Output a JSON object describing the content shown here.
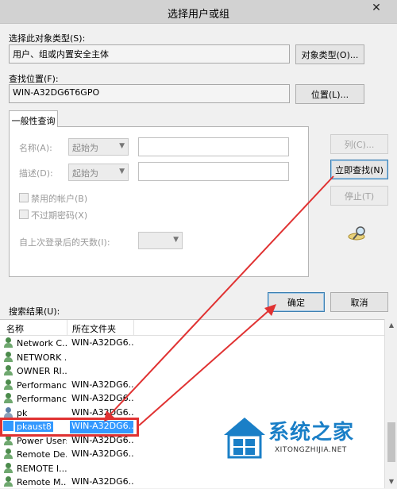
{
  "dialog": {
    "title": "选择用户或组",
    "close_glyph": "✕"
  },
  "object_type": {
    "label": "选择此对象类型(S):",
    "value": "用户、组或内置安全主体",
    "button": "对象类型(O)..."
  },
  "location": {
    "label": "查找位置(F):",
    "value": "WIN-A32DG6T6GPO",
    "button": "位置(L)..."
  },
  "query": {
    "tab": "一般性查询",
    "name_label": "名称(A):",
    "name_mode": "起始为",
    "desc_label": "描述(D):",
    "desc_mode": "起始为",
    "disabled_accounts": "禁用的帐户(B)",
    "non_expiring_pwd": "不过期密码(X)",
    "days_since_login": "自上次登录后的天数(I):"
  },
  "side_buttons": {
    "columns": "列(C)...",
    "find_now": "立即查找(N)",
    "stop": "停止(T)"
  },
  "results": {
    "label": "搜索结果(U):",
    "ok": "确定",
    "cancel": "取消",
    "col_name": "名称",
    "col_folder": "所在文件夹",
    "rows": [
      {
        "name": "Network C...",
        "folder": "WIN-A32DG6...",
        "icon": "group-icon"
      },
      {
        "name": "NETWORK ...",
        "folder": "",
        "icon": "group-icon"
      },
      {
        "name": "OWNER RI...",
        "folder": "",
        "icon": "group-icon"
      },
      {
        "name": "Performanc...",
        "folder": "WIN-A32DG6...",
        "icon": "group-icon"
      },
      {
        "name": "Performanc...",
        "folder": "WIN-A32DG6...",
        "icon": "group-icon"
      },
      {
        "name": "pk",
        "folder": "WIN-A32DG6...",
        "icon": "user-icon"
      },
      {
        "name": "pkaust8",
        "folder": "WIN-A32DG6...",
        "icon": "user-icon",
        "selected": true
      },
      {
        "name": "Power Users",
        "folder": "WIN-A32DG6...",
        "icon": "group-icon"
      },
      {
        "name": "Remote De...",
        "folder": "WIN-A32DG6...",
        "icon": "group-icon"
      },
      {
        "name": "REMOTE I...",
        "folder": "",
        "icon": "group-icon"
      },
      {
        "name": "Remote M...",
        "folder": "WIN-A32DG6...",
        "icon": "group-icon"
      }
    ]
  },
  "watermark": {
    "brand": "系统之家",
    "url": "XITONGZHIJIA.NET"
  },
  "colors": {
    "selection": "#3399ff",
    "annotation": "#e03232",
    "brand": "#1a7fc7"
  }
}
